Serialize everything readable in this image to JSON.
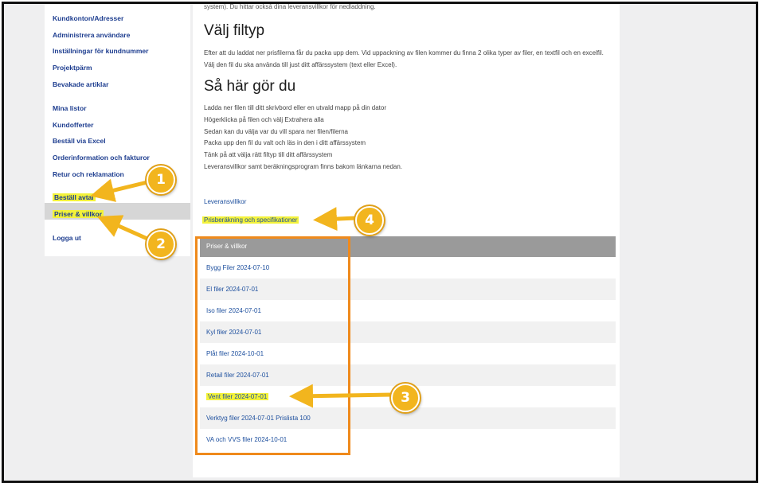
{
  "sidebar": {
    "items": [
      {
        "label": "Kundkonton/Adresser"
      },
      {
        "label": "Administrera användare"
      },
      {
        "label": "Inställningar för kundnummer"
      },
      {
        "label": "Projektpärm"
      },
      {
        "label": "Bevakade artiklar"
      },
      {
        "label": "Mina listor"
      },
      {
        "label": "Kundofferter"
      },
      {
        "label": "Beställ via Excel"
      },
      {
        "label": "Orderinformation och fakturor"
      },
      {
        "label": "Retur och reklamation"
      },
      {
        "label": "Beställ avtal"
      },
      {
        "label": "Priser & villkor"
      },
      {
        "label": "Logga ut"
      }
    ]
  },
  "main": {
    "cut_text": "system). Du hittar också dina leveransvillkor för nedladdning.",
    "section1": {
      "heading": "Välj filtyp",
      "text": "Efter att du laddat ner prisfilerna får du packa upp dem. Vid uppackning av filen kommer du finna 2 olika typer av filer, en textfil och en excelfil. Välj den fil du ska använda till just ditt affärssystem (text eller Excel)."
    },
    "section2": {
      "heading": "Så här gör du",
      "steps": [
        "Ladda ner filen till ditt skrivbord eller en utvald mapp på din dator",
        "Högerklicka på filen och välj Extrahera alla",
        "Sedan kan du välja var du vill spara ner filen/filerna",
        "Packa upp den fil du valt och läs in den i ditt affärssystem",
        "Tänk på att välja rätt filtyp till ditt affärssystem",
        "Leveransvillkor samt beräkningsprogram finns bakom länkarna nedan."
      ]
    },
    "links": {
      "delivery": "Leveransvillkor",
      "price_calc": "Prisberäkning och specifikationer"
    },
    "table": {
      "header": "Priser & villkor",
      "rows": [
        "Bygg Filer 2024-07-10",
        "El filer 2024-07-01",
        "Iso filer 2024-07-01",
        "Kyl filer 2024-07-01",
        "Plåt filer 2024-10-01",
        "Retail filer 2024-07-01",
        "Vent filer 2024-07-01",
        "Verktyg filer 2024-07-01 Prislista 100",
        "VA och VVS filer 2024-10-01"
      ]
    }
  },
  "annotations": {
    "markers": [
      "1",
      "2",
      "3",
      "4"
    ],
    "highlight_color": "#f3f23a",
    "marker_color": "#f2b51e",
    "box_color": "#ef8a1c"
  }
}
